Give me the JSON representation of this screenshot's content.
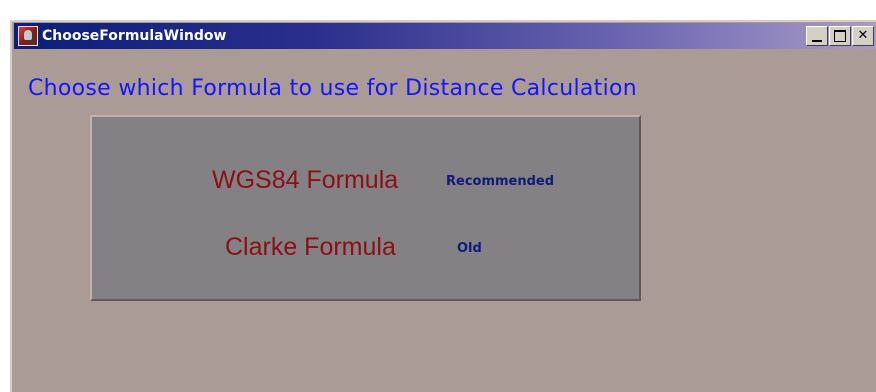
{
  "window": {
    "title": "ChooseFormulaWindow",
    "buttons": {
      "minimize": "",
      "maximize": "",
      "close": "✕"
    }
  },
  "main": {
    "heading": "Choose which Formula to use for Distance Calculation",
    "options": [
      {
        "label": "WGS84 Formula",
        "note": "Recommended"
      },
      {
        "label": "Clarke Formula",
        "note": "Old"
      }
    ]
  },
  "icons": {
    "app": "app-icon",
    "minimize": "minimize-icon",
    "maximize": "maximize-icon",
    "close": "close-icon"
  },
  "colors": {
    "heading": "#1414ff",
    "formula_label": "#8b0f14",
    "note_label": "#0f1a7a",
    "window_background": "#aa9b96",
    "panel_background": "#838183",
    "titlebar_start": "#0a1f7a",
    "titlebar_end": "#a89cc8"
  }
}
